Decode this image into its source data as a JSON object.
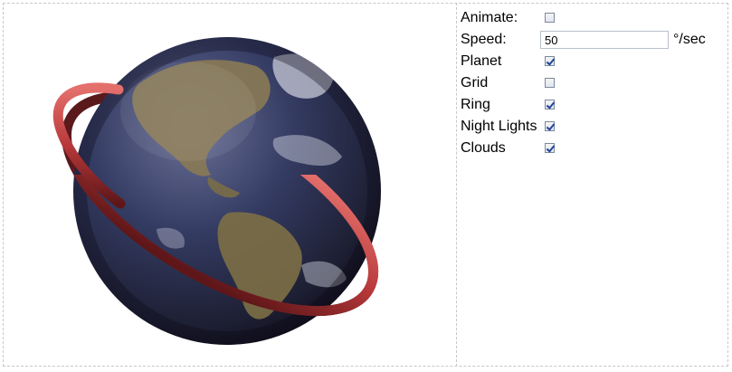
{
  "controls": {
    "animate": {
      "label": "Animate:",
      "checked": false
    },
    "speed": {
      "label": "Speed:",
      "value": "50",
      "unit": "°/sec"
    },
    "planet": {
      "label": "Planet",
      "checked": true
    },
    "grid": {
      "label": "Grid",
      "checked": false
    },
    "ring": {
      "label": "Ring",
      "checked": true
    },
    "night_lights": {
      "label": "Night Lights",
      "checked": true
    },
    "clouds": {
      "label": "Clouds",
      "checked": true
    }
  },
  "colors": {
    "ring": "#b8383a",
    "ocean": "#2a3457",
    "land": "#8a7a55",
    "border": "#c8c8c8"
  }
}
